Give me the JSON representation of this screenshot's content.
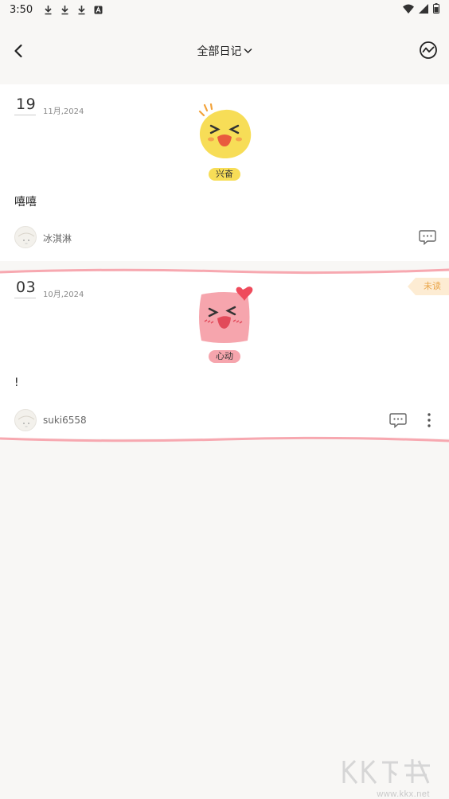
{
  "status_bar": {
    "time": "3:50"
  },
  "header": {
    "title": "全部日记"
  },
  "entries": [
    {
      "day": "19",
      "month_year": "11月,2024",
      "mood_icon": "excited-face-icon",
      "mood_label": "兴奋",
      "mood_color": "#f7dd57",
      "content": "嘻嘻",
      "author": "冰淇淋"
    },
    {
      "day": "03",
      "month_year": "10月,2024",
      "mood_icon": "heartbeat-face-icon",
      "mood_label": "心动",
      "mood_color": "#f6a5ad",
      "content": "!",
      "author": "suki6558",
      "badge": "未读"
    }
  ],
  "watermark": {
    "text": "www.kkx.net"
  }
}
